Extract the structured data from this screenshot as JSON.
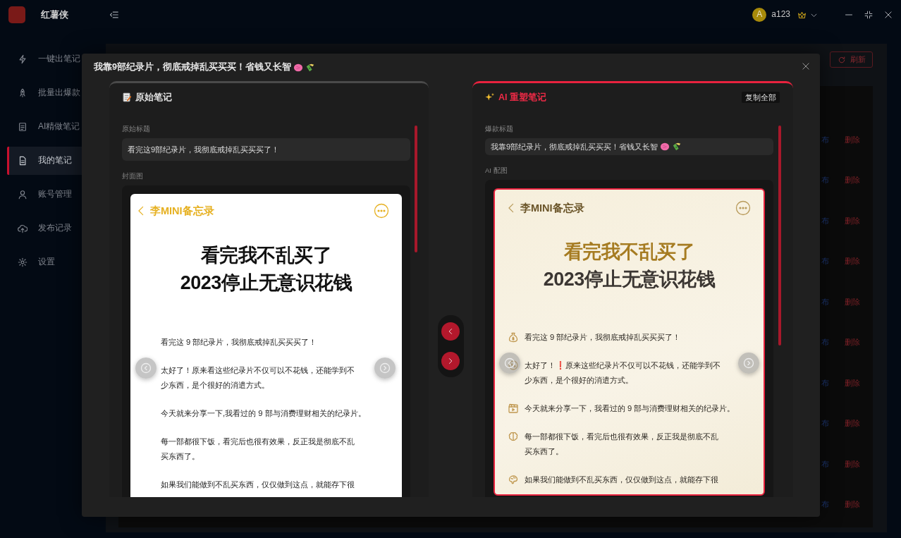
{
  "app": {
    "name": "红薯侠",
    "user": {
      "initial": "A",
      "name": "a123"
    }
  },
  "sidebar": {
    "items": [
      {
        "label": "一键出笔记",
        "selected": false
      },
      {
        "label": "批量出爆款",
        "selected": false
      },
      {
        "label": "AI精做笔记",
        "selected": false
      },
      {
        "label": "我的笔记",
        "selected": true
      },
      {
        "label": "账号管理",
        "selected": false
      },
      {
        "label": "发布记录",
        "selected": false
      },
      {
        "label": "设置",
        "selected": false
      }
    ]
  },
  "toolbar": {
    "refresh_button": "刷新"
  },
  "table": {
    "rows": [
      {
        "publish": "布",
        "delete": "删除"
      },
      {
        "publish": "布",
        "delete": "删除"
      },
      {
        "publish": "布",
        "delete": "删除"
      },
      {
        "publish": "布",
        "delete": "删除"
      },
      {
        "publish": "布",
        "delete": "删除"
      },
      {
        "publish": "布",
        "delete": "删除"
      },
      {
        "publish": "布",
        "delete": "删除"
      },
      {
        "publish": "布",
        "delete": "删除"
      },
      {
        "publish": "布",
        "delete": "删除"
      },
      {
        "publish": "布",
        "delete": "删除"
      }
    ]
  },
  "dialog": {
    "title": "我靠9部纪录片，彻底戒掉乱买买买！省钱又长智",
    "original": {
      "heading": "原始笔记",
      "title_label": "原始标题",
      "title_value": "看完这9部纪录片，我彻底戒掉乱买买买了！",
      "image_label": "封面图",
      "image": {
        "kind": "plain",
        "app_name": "李MINI备忘录",
        "headline": [
          "看完我不乱买了",
          "2023停止无意识花钱"
        ],
        "paragraphs": [
          {
            "lines": [
              "看完这 9 部纪录片，我彻底戒掉乱买买买了！"
            ]
          },
          {
            "lines": [
              "太好了！原来看这些纪录片不仅可以不花钱，还能学到不",
              "少东西，是个很好的消遣方式。"
            ]
          },
          {
            "lines": [
              "今天就来分享一下,我看过的 9 部与消费理财相关的纪录片。"
            ]
          },
          {
            "lines": [
              "每一部都很下饭，看完后也很有效果，反正我是彻底不乱",
              "买东西了。"
            ]
          },
          {
            "lines": [
              "如果我们能做到不乱买东西，仅仅做到这点，就能存下很"
            ]
          }
        ]
      }
    },
    "rewritten": {
      "heading": "AI 重塑笔记",
      "copy_button": "复制全部",
      "title_label": "爆款标题",
      "title_value": "我靠9部纪录片，彻底戒掉乱买买买！省钱又长智",
      "image_label": "AI 配图",
      "image": {
        "kind": "parchment",
        "app_name": "李MINI备忘录",
        "headline": [
          "看完我不乱买了",
          "2023停止无意识花钱"
        ],
        "paragraphs": [
          {
            "lines": [
              "看完这 9 部纪录片，我彻底戒掉乱买买买了！"
            ]
          },
          {
            "lines": [
              "太好了！❗原来这些纪录片不仅可以不花钱，还能学到不",
              "少东西，是个很好的消遣方式。"
            ]
          },
          {
            "lines": [
              "今天就来分享一下，我看过的 9 部与消费理财相关的纪录片。"
            ]
          },
          {
            "lines": [
              "每一部都很下饭，看完后也很有效果，反正我是彻底不乱",
              "买东西了。"
            ]
          },
          {
            "lines": [
              "如果我们能做到不乱买东西，仅仅做到这点，就能存下很"
            ]
          }
        ]
      }
    }
  }
}
